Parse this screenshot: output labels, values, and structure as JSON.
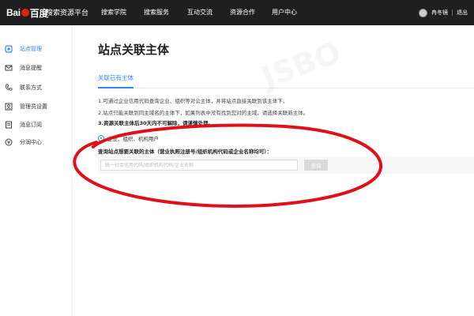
{
  "topbar": {
    "logo_text_left": "Bai",
    "logo_text_right": "百度",
    "platform_title": "搜索资源平台",
    "nav": [
      {
        "label": "搜索学院"
      },
      {
        "label": "搜索服务"
      },
      {
        "label": "互动交流"
      },
      {
        "label": "资源合作"
      },
      {
        "label": "用户中心"
      }
    ],
    "username": "冉冬镜",
    "logout": "退出"
  },
  "sidebar": {
    "items": [
      {
        "label": "站点管理",
        "icon": "site-icon",
        "active": true
      },
      {
        "label": "消息提醒",
        "icon": "message-icon"
      },
      {
        "label": "联系方式",
        "icon": "phone-icon"
      },
      {
        "label": "管理员设置",
        "icon": "admin-icon"
      },
      {
        "label": "消息订阅",
        "icon": "subscribe-icon"
      },
      {
        "label": "分润中心",
        "icon": "revenue-icon"
      }
    ]
  },
  "main": {
    "title": "站点关联主体",
    "tab": "关联已有主体",
    "notes": [
      "1.可通过企业信用代码查询企业、组织等对公主体，并将站点直接关联到该主体下。",
      "2.站点只能关联到同主域名的主体下，如果列表中没有找到您对的主域，请选择关联新主体。",
      "3.资源关联主体后30天内不可解除，请谨慎处理。"
    ],
    "radio_label": "企业、组织、机构用户",
    "query_label": "查询站点想要关联的主体（营业执照注册号/组织机构代码或企业名称均可）：",
    "search_placeholder": "统一社会信用代码/组织机构代码/企业名称",
    "search_button": "查询"
  },
  "colors": {
    "accent": "#3385ff",
    "topbar_bg": "#1f1f1f",
    "annotation": "#e0101a"
  },
  "watermark": "JSBO"
}
